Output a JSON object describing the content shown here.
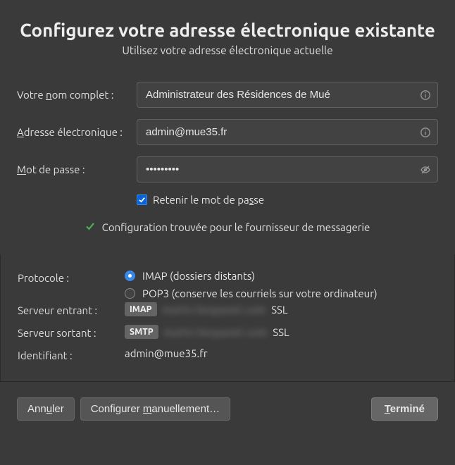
{
  "header": {
    "title": "Configurez votre adresse électronique existante",
    "subtitle": "Utilisez votre adresse électronique actuelle"
  },
  "form": {
    "name_label_pre": "Votre ",
    "name_label_u": "n",
    "name_label_post": "om complet :",
    "name_value": "Administrateur des Résidences de Mué",
    "address_label_u": "A",
    "address_label_post": "dresse électronique :",
    "address_value": "admin@mue35.fr",
    "password_label_u": "M",
    "password_label_post": "ot de passe :",
    "password_value": "•••••••••",
    "remember_pre": "Retenir le mot de pa",
    "remember_u": "s",
    "remember_post": "se",
    "remember_checked": true
  },
  "status": {
    "message": "Configuration trouvée pour le fournisseur de messagerie"
  },
  "details": {
    "protocol_label": "Protocole :",
    "imap_label": "IMAP (dossiers distants)",
    "pop3_label": "POP3 (conserve les courriels sur votre ordinateur)",
    "selected_protocol": "imap",
    "incoming_label": "Serveur entrant :",
    "outgoing_label": "Serveur sortant :",
    "identity_label": "Identifiant :",
    "incoming_proto": "IMAP",
    "outgoing_proto": "SMTP",
    "incoming_host": "mailin.hespanel.com",
    "outgoing_host": "mailin.hespanel.com",
    "ssl": "SSL",
    "identity": "admin@mue35.fr"
  },
  "buttons": {
    "cancel_pre": "Ann",
    "cancel_u": "u",
    "cancel_post": "ler",
    "manual_pre": "Configurer ",
    "manual_u": "m",
    "manual_post": "anuellement…",
    "done_u": "T",
    "done_post": "erminé"
  }
}
